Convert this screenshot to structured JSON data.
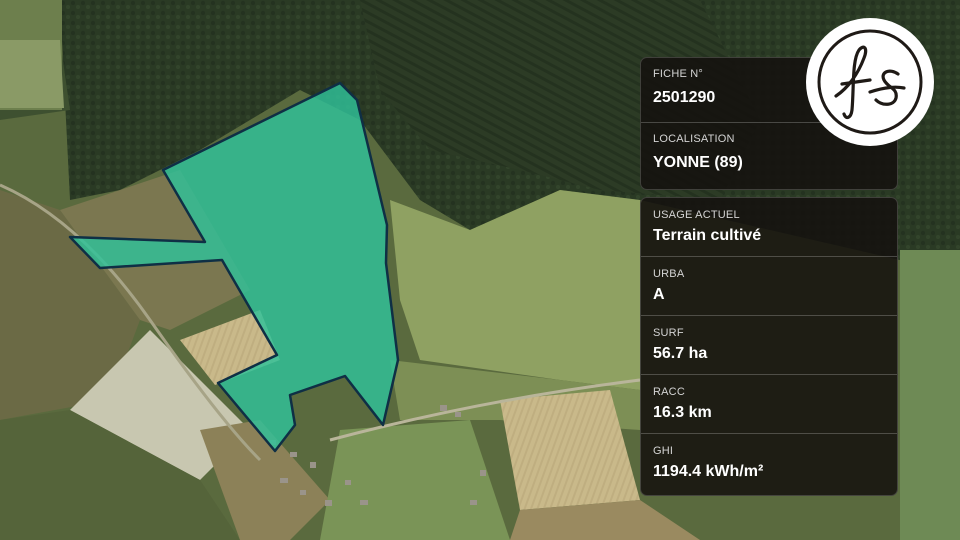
{
  "brand": {
    "logo_text": "fs"
  },
  "map": {
    "parcel_fill_color": "#2fc29a",
    "parcel_outline_color": "#0f2f45"
  },
  "card_location": {
    "fiche": {
      "label": "FICHE N°",
      "value": "2501290"
    },
    "localisation": {
      "label": "LOCALISATION",
      "value": "YONNE (89)"
    }
  },
  "card_details": {
    "usage": {
      "label": "USAGE ACTUEL",
      "value": "Terrain cultivé"
    },
    "urba": {
      "label": "URBA",
      "value": "A"
    },
    "surf": {
      "label": "SURF",
      "value": "56.7 ha"
    },
    "racc": {
      "label": "RACC",
      "value": "16.3 km"
    },
    "ghi": {
      "label": "GHI",
      "value": "1194.4 kWh/m²"
    }
  }
}
